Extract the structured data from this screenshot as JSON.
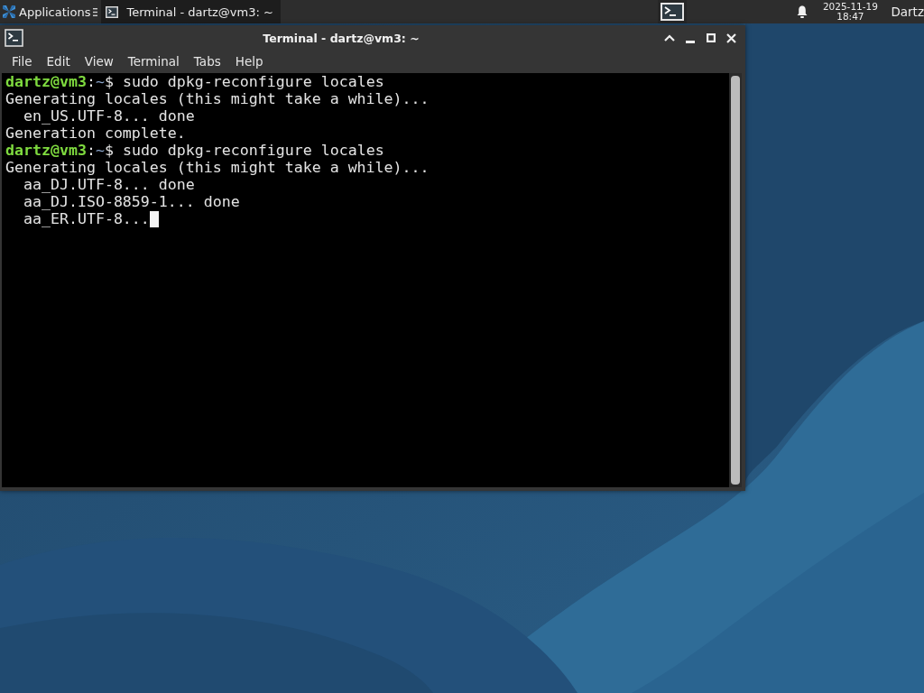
{
  "panel": {
    "app_menu": {
      "label": "Applications"
    },
    "tasks": [
      {
        "title": "Terminal - dartz@vm3: ~",
        "selected": true
      }
    ],
    "clock": {
      "date": "2025-11-19",
      "time": "18:47"
    },
    "user": "Dartz"
  },
  "window": {
    "title": "Terminal - dartz@vm3: ~",
    "menu": [
      "File",
      "Edit",
      "View",
      "Terminal",
      "Tabs",
      "Help"
    ],
    "lines": [
      {
        "kind": "prompt",
        "segments": [
          {
            "kind": "user",
            "text": "dartz@vm3"
          },
          {
            "kind": "plain",
            "text": ":"
          },
          {
            "kind": "path",
            "text": "~"
          },
          {
            "kind": "plain",
            "text": "$ sudo dpkg-reconfigure locales"
          }
        ],
        "cursor": false
      },
      {
        "kind": "output",
        "text": "Generating locales (this might take a while)...",
        "cursor": false
      },
      {
        "kind": "output",
        "text": "  en_US.UTF-8... done",
        "cursor": false
      },
      {
        "kind": "output",
        "text": "Generation complete.",
        "cursor": false
      },
      {
        "kind": "prompt",
        "segments": [
          {
            "kind": "user",
            "text": "dartz@vm3"
          },
          {
            "kind": "plain",
            "text": ":"
          },
          {
            "kind": "path",
            "text": "~"
          },
          {
            "kind": "plain",
            "text": "$ sudo dpkg-reconfigure locales"
          }
        ],
        "cursor": false
      },
      {
        "kind": "output",
        "text": "Generating locales (this might take a while)...",
        "cursor": false
      },
      {
        "kind": "output",
        "text": "  aa_DJ.UTF-8... done",
        "cursor": false
      },
      {
        "kind": "output",
        "text": "  aa_DJ.ISO-8859-1... done",
        "cursor": false
      },
      {
        "kind": "output",
        "text": "  aa_ER.UTF-8...",
        "cursor": true
      }
    ]
  }
}
